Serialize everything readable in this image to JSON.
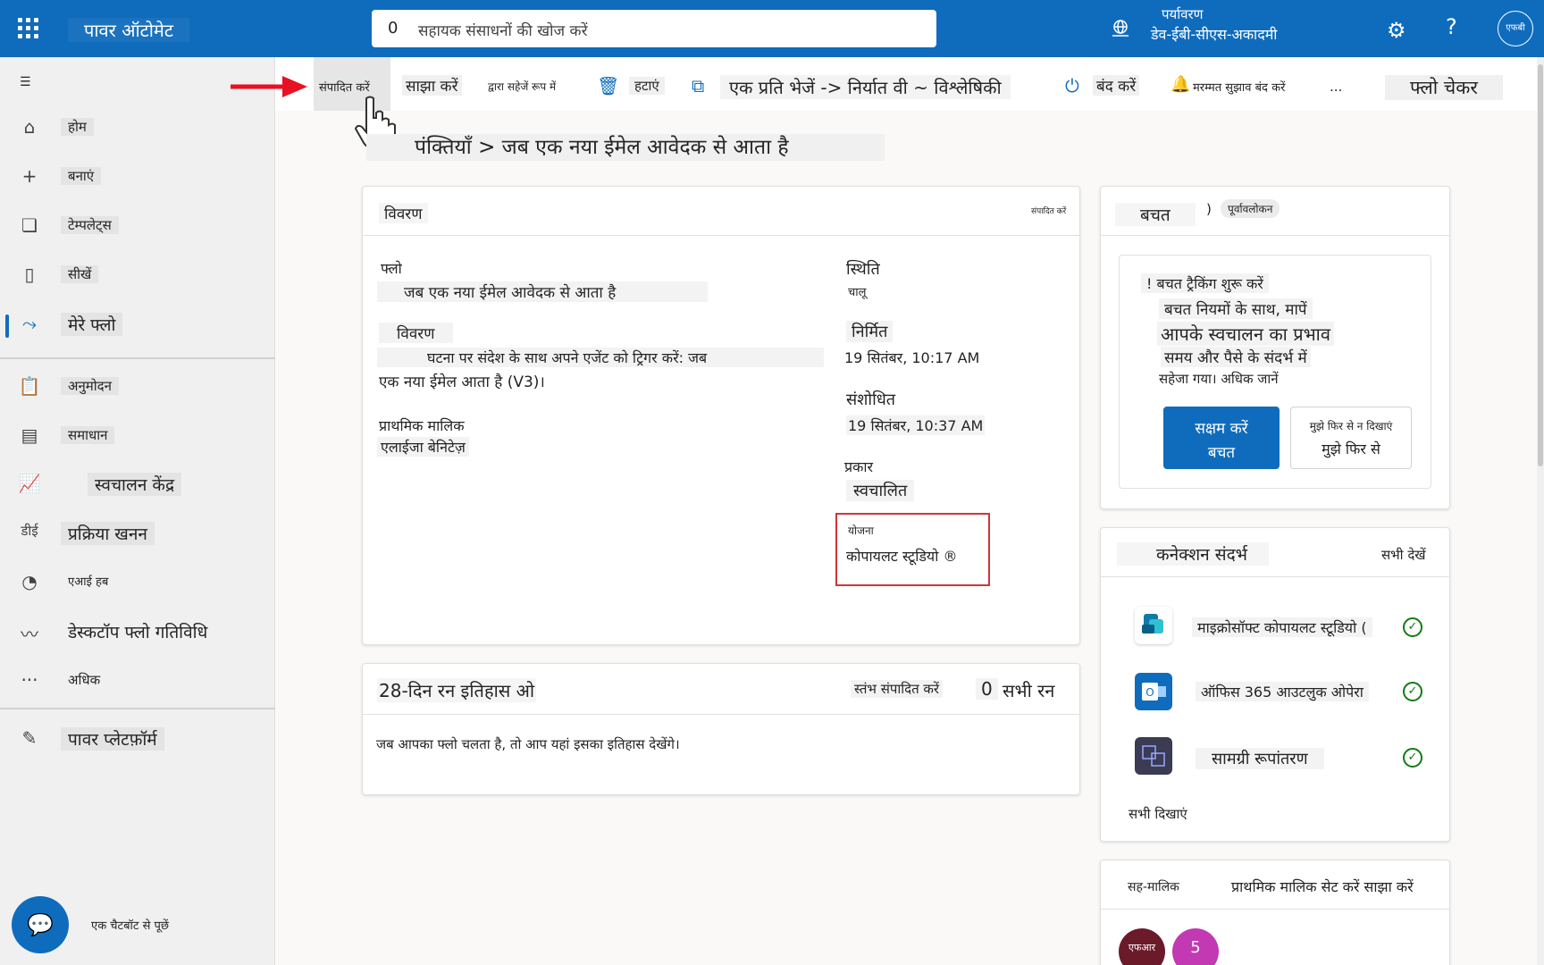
{
  "header": {
    "app_title": "पावर ऑटोमेट",
    "search_count": "0",
    "search_placeholder": "सहायक संसाधनों की खोज करें",
    "env_label": "पर्यावरण",
    "env_name": "डेव-ईबी-सीएस-अकादमी",
    "avatar": "एफबी"
  },
  "nav": {
    "items": [
      {
        "label": "होम",
        "icon": "home-icon"
      },
      {
        "label": "बनाएं",
        "icon": "plus-icon"
      },
      {
        "label": "टेम्पलेट्स",
        "icon": "templates-icon"
      },
      {
        "label": "सीखें",
        "icon": "book-icon"
      },
      {
        "label": "मेरे फ्लो",
        "icon": "flow-icon"
      },
      {
        "label": "अनुमोदन",
        "icon": "approvals-icon"
      },
      {
        "label": "समाधान",
        "icon": "solutions-icon"
      },
      {
        "label": "स्वचालन केंद्र",
        "icon": "chart-icon"
      },
      {
        "label": "प्रक्रिया खनन",
        "icon": "process-mining-icon"
      },
      {
        "label": "एआई हब",
        "icon": "ai-hub-icon"
      },
      {
        "label": "डेस्कटॉप फ्लो गतिविधि",
        "icon": "activity-icon"
      },
      {
        "label": "अधिक",
        "icon": "more-icon"
      },
      {
        "label": "पावर प्लेटफ़ॉर्म",
        "icon": "power-platform-icon"
      }
    ],
    "ddi_prefix": "डीई",
    "chatbot_label": "एक चैटबॉट से पूछें"
  },
  "commands": {
    "edit": "संपादित करें",
    "share": "साझा करें",
    "save_as": "द्वारा सहेजें रूप में",
    "delete": "हटाएं",
    "send_copy": "एक प्रति भेजें -> निर्यात वी ~ विश्लेषिकी",
    "turn_off": "बंद करें",
    "repair_tips": "मरम्मत सुझाव बंद करें",
    "more": "...",
    "flow_checker": "फ्लो चेकर"
  },
  "breadcrumb": "पंक्तियाँ > जब एक नया ईमेल आवेदक से आता है",
  "details": {
    "title": "विवरण",
    "edit_link": "संपादित करें",
    "flow_label": "फ्लो",
    "flow_value": "जब एक नया ईमेल आवेदक से आता है",
    "desc_label": "विवरण",
    "desc_line1": "घटना पर संदेश के साथ अपने एजेंट को ट्रिगर करें: जब",
    "desc_line2": "एक नया ईमेल आता है (V3)।",
    "owner_label": "प्राथमिक मालिक",
    "owner_value": "एलाईजा बेनिटेज़",
    "status_label": "स्थिति",
    "status_value": "चालू",
    "created_label": "निर्मित",
    "created_value": "19 सितंबर, 10:17 AM",
    "modified_label": "संशोधित",
    "modified_value": "19 सितंबर, 10:37 AM",
    "type_label": "प्रकार",
    "type_value": "स्वचालित",
    "plan_label": "योजना",
    "plan_value": "कोपायलट स्टूडियो ®"
  },
  "run_history": {
    "title": "28-दिन रन इतिहास ओ",
    "edit_columns": "स्तंभ संपादित करें",
    "count": "0",
    "all_runs": "सभी रन",
    "empty_text": "जब आपका फ्लो चलता है, तो आप यहां इसका इतिहास देखेंगे।"
  },
  "savings": {
    "title": "बचत",
    "paren": ")",
    "preview_badge": "पूर्वावलोकन",
    "line1": "! बचत ट्रैकिंग शुरू करें",
    "line2": "बचत नियमों के साथ, मापें",
    "line3": "आपके स्वचालन का प्रभाव",
    "line4": "समय और पैसे के संदर्भ में",
    "line5": "सहेजा गया। अधिक जानें",
    "enable_line1": "सक्षम करें",
    "enable_line2": "बचत",
    "dismiss_line1": "मुझे फिर से न दिखाएं",
    "dismiss_line2": "मुझे फिर से"
  },
  "connections": {
    "title": "कनेक्शन संदर्भ",
    "see_all": "सभी देखें",
    "items": [
      {
        "name": "माइक्रोसॉफ्ट कोपायलट स्टूडियो (",
        "icon": "copilot-studio-icon"
      },
      {
        "name": "ऑफिस 365 आउटलुक ओपेरा",
        "icon": "outlook-icon"
      },
      {
        "name": "सामग्री रूपांतरण",
        "icon": "content-conversion-icon"
      }
    ],
    "show_all": "सभी दिखाएं"
  },
  "coowners": {
    "title": "सह-मालिक",
    "actions": "प्राथमिक मालिक सेट करें साझा करें",
    "avatars": [
      {
        "initials": "एफआर",
        "color": "#6b1a2a"
      },
      {
        "initials": "5",
        "color": "#c239b3"
      }
    ]
  },
  "colors": {
    "brand": "#0f6cbd",
    "highlight": "#d13438",
    "success": "#107c10"
  }
}
